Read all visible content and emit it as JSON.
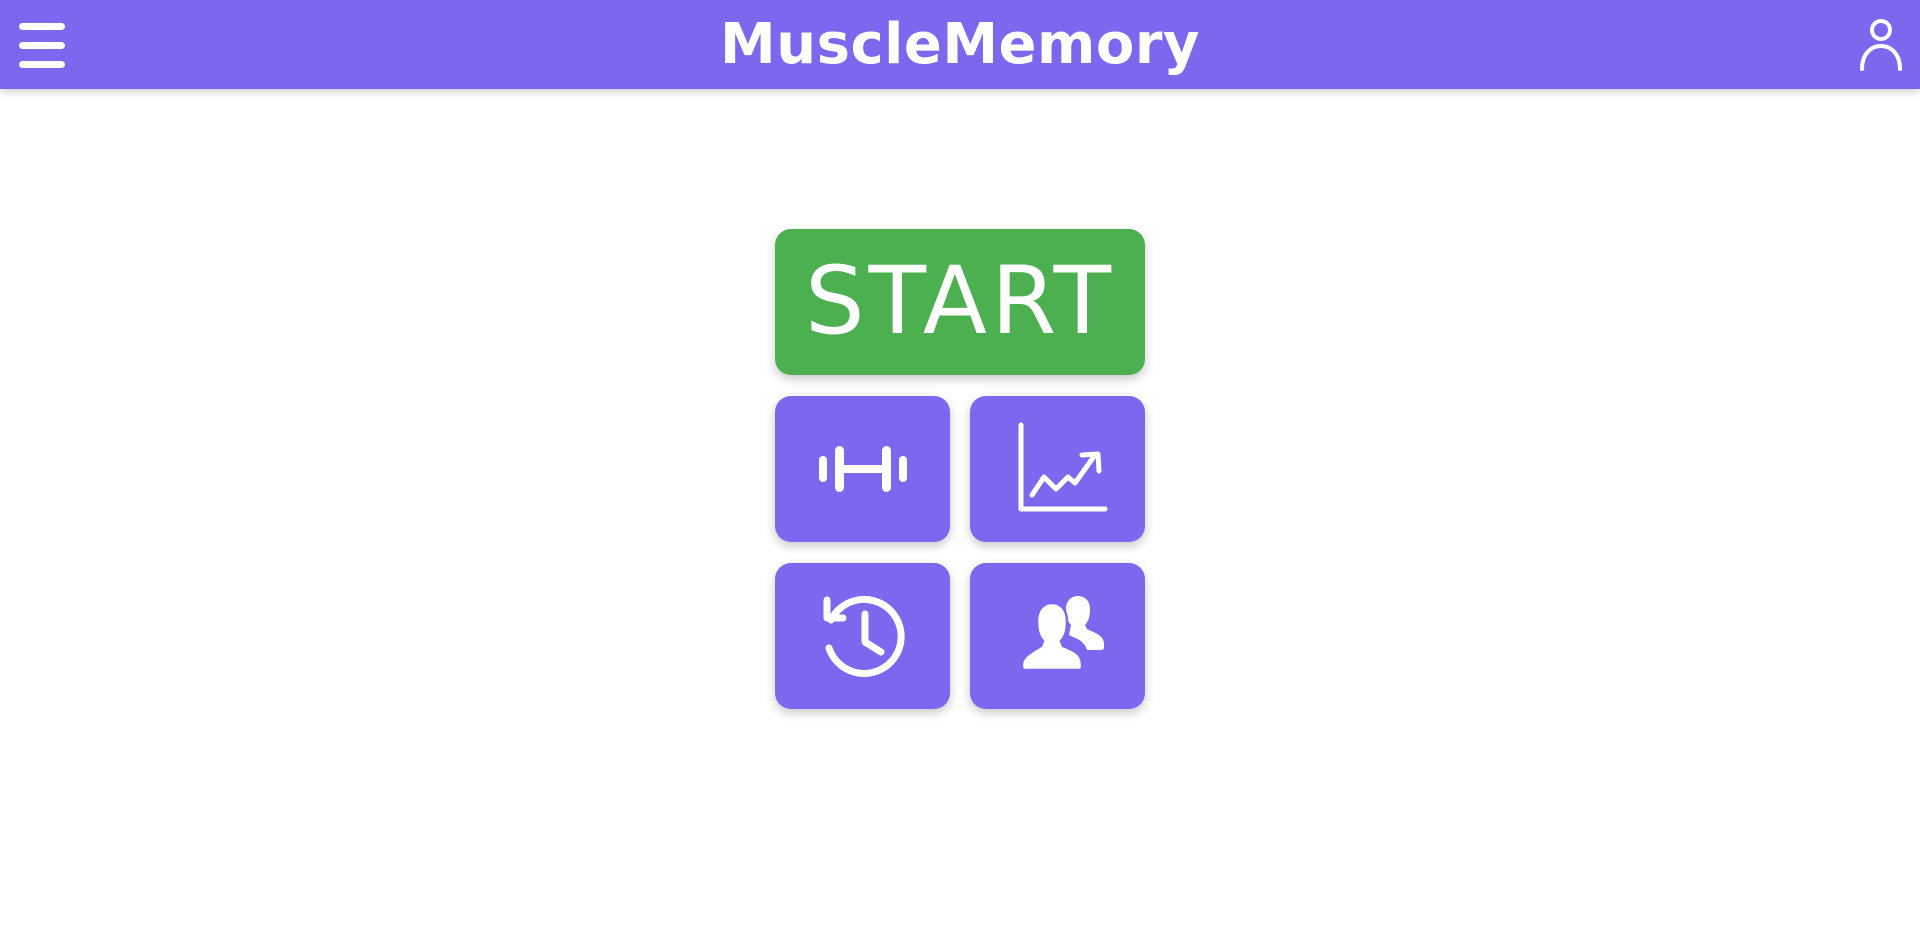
{
  "header": {
    "title": "MuscleMemory",
    "menu_icon": "menu-icon",
    "account_icon": "account-icon",
    "background_color": "#7b68ee"
  },
  "main": {
    "start_button": {
      "label": "START",
      "color": "#4caf50"
    },
    "tiles": [
      {
        "name": "workouts",
        "icon": "dumbbell-icon",
        "color": "#7b68ee"
      },
      {
        "name": "progress",
        "icon": "trending-chart-icon",
        "color": "#7b68ee"
      },
      {
        "name": "history",
        "icon": "history-clock-icon",
        "color": "#7b68ee"
      },
      {
        "name": "friends",
        "icon": "people-icon",
        "color": "#7b68ee"
      }
    ]
  }
}
